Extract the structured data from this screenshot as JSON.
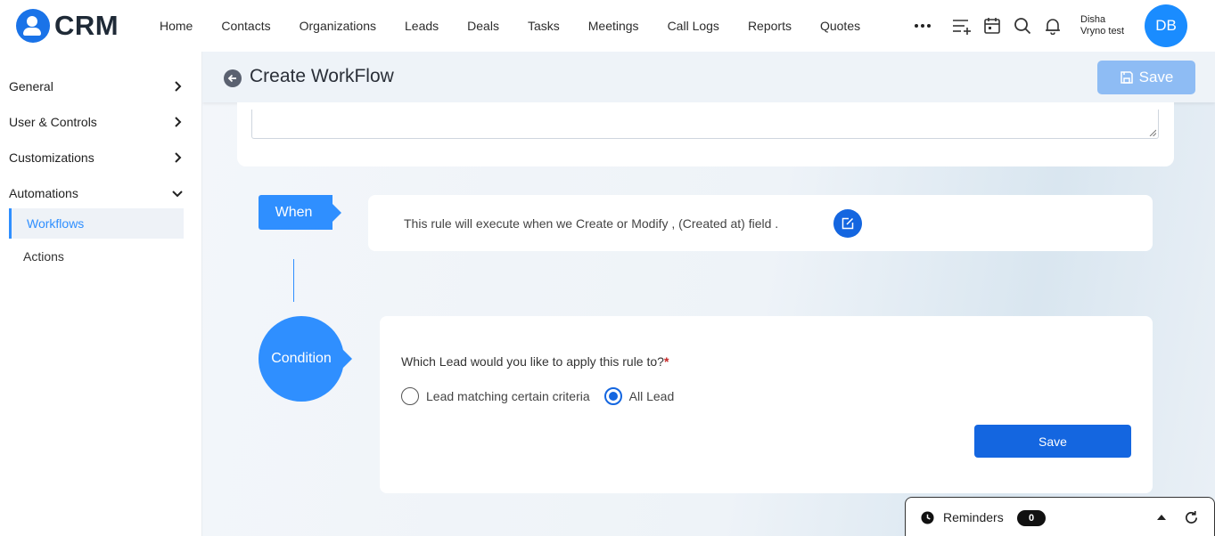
{
  "app": {
    "logo_text": "CRM",
    "accent": "#2f8fff",
    "primary": "#1466e0"
  },
  "nav": {
    "items": [
      "Home",
      "Contacts",
      "Organizations",
      "Leads",
      "Deals",
      "Tasks",
      "Meetings",
      "Call Logs",
      "Reports",
      "Quotes"
    ],
    "icons": [
      "more-icon",
      "add-list-icon",
      "calendar-icon",
      "search-icon",
      "bell-icon"
    ]
  },
  "user": {
    "first": "Disha",
    "second": "Vryno test",
    "initials": "DB"
  },
  "sidebar": {
    "items": [
      {
        "label": "General",
        "expanded": false
      },
      {
        "label": "User & Controls",
        "expanded": false
      },
      {
        "label": "Customizations",
        "expanded": false
      },
      {
        "label": "Automations",
        "expanded": true
      }
    ],
    "sub_items": [
      {
        "label": "Workflows",
        "active": true
      },
      {
        "label": "Actions",
        "active": false
      }
    ]
  },
  "header": {
    "title": "Create WorkFlow",
    "save_label": "Save"
  },
  "when": {
    "tag": "When",
    "text": "This rule will execute when we Create or Modify , (Created at) field ."
  },
  "condition": {
    "tag": "Condition",
    "question": "Which Lead would you like to apply this rule to?",
    "required_mark": "*",
    "options": [
      {
        "label": "Lead matching certain criteria",
        "checked": false
      },
      {
        "label": "All Lead",
        "checked": true
      }
    ],
    "save_label": "Save"
  },
  "reminders": {
    "label": "Reminders",
    "count": "0"
  }
}
